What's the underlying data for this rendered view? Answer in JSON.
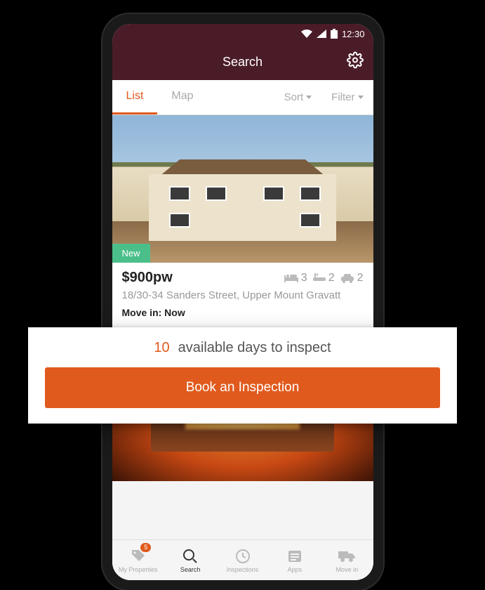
{
  "statusbar": {
    "time": "12:30"
  },
  "appbar": {
    "title": "Search"
  },
  "tabs": {
    "list": "List",
    "map": "Map",
    "sort": "Sort",
    "filter": "Filter"
  },
  "listing": {
    "badge": "New",
    "price": "$900pw",
    "beds": "3",
    "baths": "2",
    "cars": "2",
    "address": "18/30-34 Sanders Street, Upper Mount Gravatt",
    "movein_label": "Move in: ",
    "movein_value": "Now"
  },
  "overlay": {
    "count": "10",
    "text": "available days to inspect",
    "button": "Book an Inspection"
  },
  "nav": {
    "myprops": "My Properties",
    "badge": "5",
    "search": "Search",
    "inspections": "Inspections",
    "apps": "Apps",
    "movein": "Move in"
  }
}
